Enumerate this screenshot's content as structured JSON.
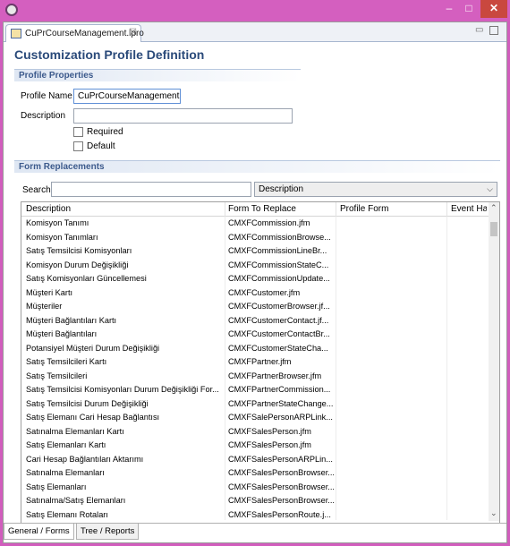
{
  "window": {
    "minimize": "–",
    "maximize": "□",
    "close": "✕"
  },
  "editor_tab": {
    "label": "CuPrCourseManagement.lpro",
    "close": "☒"
  },
  "view_controls": {
    "minimize": "▭"
  },
  "form_title": "Customization Profile Definition",
  "profile_properties": {
    "header": "Profile Properties",
    "profile_name_label": "Profile Name",
    "profile_name_value": "CuPrCourseManagement",
    "description_label": "Description",
    "description_value": "",
    "required_label": "Required",
    "default_label": "Default"
  },
  "form_replacements": {
    "header": "Form Replacements",
    "search_label": "Search",
    "search_value": "",
    "search_field_select": "Description",
    "columns": [
      "Description",
      "Form To Replace",
      "Profile Form",
      "Event Han"
    ],
    "rows": [
      [
        "Komisyon Tanımı",
        "CMXFCommission.jfm"
      ],
      [
        "Komisyon Tanımları",
        "CMXFCommissionBrowse..."
      ],
      [
        "Satış Temsilcisi Komisyonları",
        "CMXFCommissionLineBr..."
      ],
      [
        "Komisyon Durum Değişikliği",
        "CMXFCommissionStateC..."
      ],
      [
        "Satış Komisyonları Güncellemesi",
        "CMXFCommissionUpdate..."
      ],
      [
        "Müşteri Kartı",
        "CMXFCustomer.jfm"
      ],
      [
        "Müşteriler",
        "CMXFCustomerBrowser.jf..."
      ],
      [
        "Müşteri Bağlantıları Kartı",
        "CMXFCustomerContact.jf..."
      ],
      [
        "Müşteri Bağlantıları",
        "CMXFCustomerContactBr..."
      ],
      [
        "Potansiyel Müşteri Durum Değişikliği",
        "CMXFCustomerStateCha..."
      ],
      [
        "Satış Temsilcileri Kartı",
        "CMXFPartner.jfm"
      ],
      [
        "Satış Temsilcileri",
        "CMXFPartnerBrowser.jfm"
      ],
      [
        "Satış Temsilcisi Komisyonları Durum Değişikliği For...",
        "CMXFPartnerCommission..."
      ],
      [
        "Satış Temsilcisi Durum Değişikliği",
        "CMXFPartnerStateChange..."
      ],
      [
        "Satış Elemanı Cari Hesap Bağlantısı",
        "CMXFSalePersonARPLink..."
      ],
      [
        "Satınalma Elemanları Kartı",
        "CMXFSalesPerson.jfm"
      ],
      [
        "Satış Elemanları Kartı",
        "CMXFSalesPerson.jfm"
      ],
      [
        "Cari Hesap Bağlantıları Aktarımı",
        "CMXFSalesPersonARPLin..."
      ],
      [
        "Satınalma Elemanları",
        "CMXFSalesPersonBrowser..."
      ],
      [
        "Satış Elemanları",
        "CMXFSalesPersonBrowser..."
      ],
      [
        "Satınalma/Satış Elemanları",
        "CMXFSalesPersonBrowser..."
      ],
      [
        "Satış Elemanı Rotaları",
        "CMXFSalesPersonRoute.j..."
      ]
    ]
  },
  "bottom_tabs": [
    "General / Forms",
    "Tree / Reports"
  ]
}
